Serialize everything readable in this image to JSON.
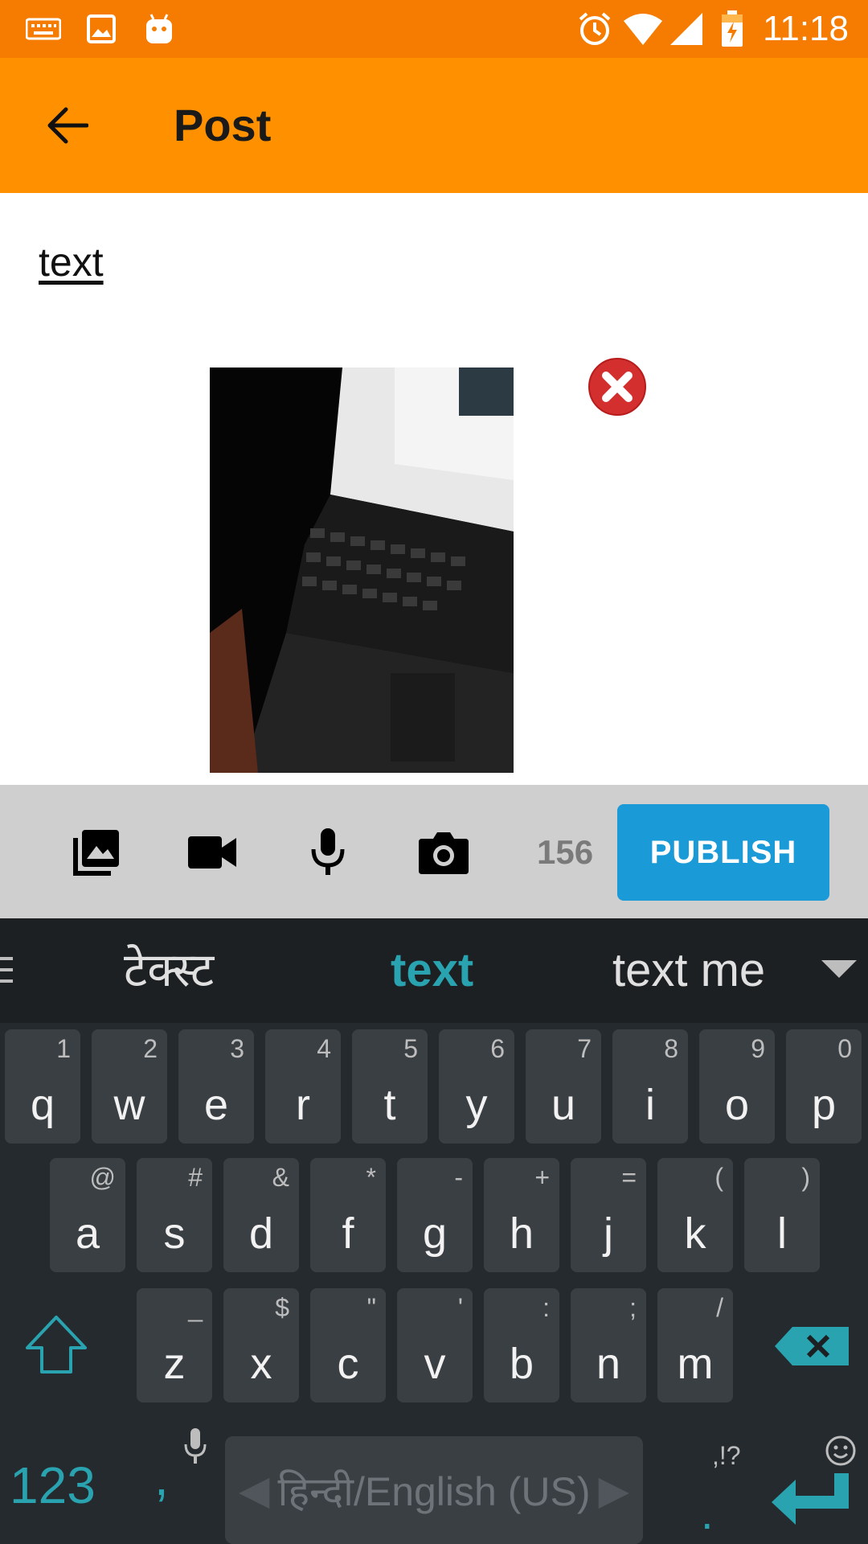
{
  "status_bar": {
    "time": "11:18",
    "icons": [
      "keyboard-icon",
      "image-icon",
      "android-icon",
      "alarm-icon",
      "wifi-icon",
      "signal-icon",
      "battery-charging-icon"
    ],
    "color": "#f57c00"
  },
  "app_bar": {
    "title": "Post",
    "color": "#ff9100"
  },
  "post": {
    "text": "text"
  },
  "action_bar": {
    "icons": [
      "gallery-icon",
      "video-camera-icon",
      "microphone-icon",
      "camera-icon"
    ],
    "char_count": "156",
    "publish_label": "PUBLISH",
    "publish_color": "#1a9ad6"
  },
  "keyboard": {
    "suggestions": [
      "टेक्स्ट",
      "text",
      "text me"
    ],
    "row1": [
      {
        "key": "q",
        "hint": "1"
      },
      {
        "key": "w",
        "hint": "2"
      },
      {
        "key": "e",
        "hint": "3"
      },
      {
        "key": "r",
        "hint": "4"
      },
      {
        "key": "t",
        "hint": "5"
      },
      {
        "key": "y",
        "hint": "6"
      },
      {
        "key": "u",
        "hint": "7"
      },
      {
        "key": "i",
        "hint": "8"
      },
      {
        "key": "o",
        "hint": "9"
      },
      {
        "key": "p",
        "hint": "0"
      }
    ],
    "row2": [
      {
        "key": "a",
        "hint": "@"
      },
      {
        "key": "s",
        "hint": "#"
      },
      {
        "key": "d",
        "hint": "&"
      },
      {
        "key": "f",
        "hint": "*"
      },
      {
        "key": "g",
        "hint": "-"
      },
      {
        "key": "h",
        "hint": "+"
      },
      {
        "key": "j",
        "hint": "="
      },
      {
        "key": "k",
        "hint": "("
      },
      {
        "key": "l",
        "hint": ")"
      }
    ],
    "row3": [
      {
        "key": "z",
        "hint": "_"
      },
      {
        "key": "x",
        "hint": "$"
      },
      {
        "key": "c",
        "hint": "\""
      },
      {
        "key": "v",
        "hint": "'"
      },
      {
        "key": "b",
        "hint": ":"
      },
      {
        "key": "n",
        "hint": ";"
      },
      {
        "key": "m",
        "hint": "/"
      }
    ],
    "numbers_label": "123",
    "comma_label": ",",
    "space_label": "हिन्दी/English (US)",
    "period_label": ".",
    "period_hint": ",!?",
    "accent_color": "#2aa3b0"
  }
}
